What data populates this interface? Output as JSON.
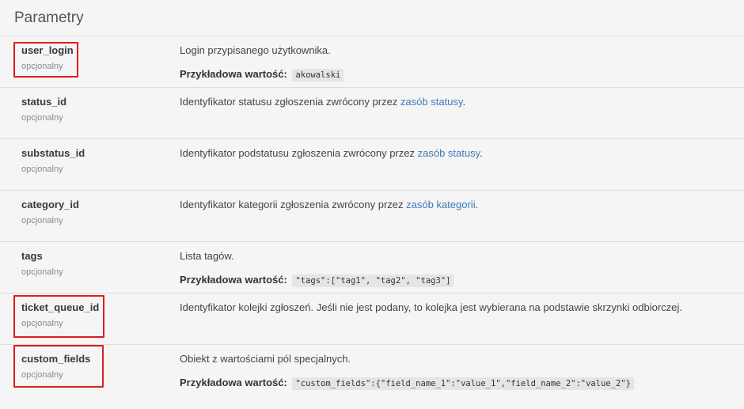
{
  "page": {
    "title": "Parametry"
  },
  "params": [
    {
      "name": "user_login",
      "req": "opcjonalny",
      "desc": "Login przypisanego użytkownika.",
      "example_label": "Przykładowa wartość:",
      "example_value": "akowalski"
    },
    {
      "name": "status_id",
      "req": "opcjonalny",
      "desc_prefix": "Identyfikator statusu zgłoszenia zwrócony przez ",
      "link": "zasób statusy",
      "desc_suffix": "."
    },
    {
      "name": "substatus_id",
      "req": "opcjonalny",
      "desc_prefix": "Identyfikator podstatusu zgłoszenia zwrócony przez ",
      "link": "zasób statusy",
      "desc_suffix": "."
    },
    {
      "name": "category_id",
      "req": "opcjonalny",
      "desc_prefix": "Identyfikator kategorii zgłoszenia zwrócony przez ",
      "link": "zasób kategorii",
      "desc_suffix": "."
    },
    {
      "name": "tags",
      "req": "opcjonalny",
      "desc": "Lista tagów.",
      "example_label": "Przykładowa wartość:",
      "example_value": "\"tags\":[\"tag1\", \"tag2\", \"tag3\"]"
    },
    {
      "name": "ticket_queue_id",
      "req": "opcjonalny",
      "desc": "Identyfikator kolejki zgłoszeń. Jeśli nie jest podany, to kolejka jest wybierana na podstawie skrzynki odbiorczej."
    },
    {
      "name": "custom_fields",
      "req": "opcjonalny",
      "desc": "Obiekt z wartościami pól specjalnych.",
      "example_label": "Przykładowa wartość:",
      "example_value": "\"custom_fields\":{\"field_name_1\":\"value_1\",\"field_name_2\":\"value_2\"}"
    }
  ],
  "colors": {
    "highlight": "#e01b1b",
    "link": "#3d7ab8",
    "background": "#f5f5f5"
  }
}
